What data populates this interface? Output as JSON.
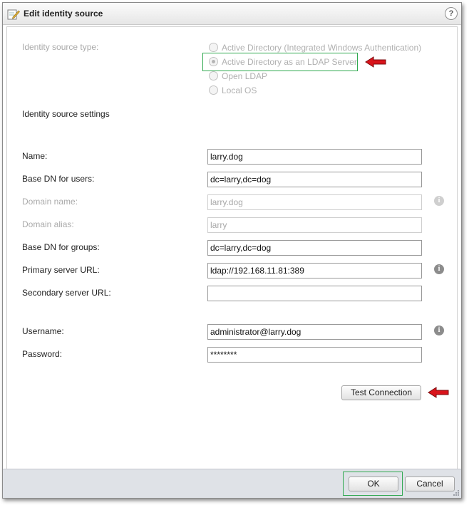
{
  "dialog": {
    "title": "Edit identity source",
    "help_label": "?",
    "icons": {
      "title": "edit-pencil-icon",
      "help": "help-icon",
      "info": "info-icon",
      "grip": "resize-grip-icon",
      "annotation": "red-arrow-icon"
    }
  },
  "source_type": {
    "label": "Identity source type:",
    "selected": "Active Directory as an LDAP Server",
    "options": [
      {
        "label": "Active Directory (Integrated Windows Authentication)",
        "checked": false
      },
      {
        "label": "Active Directory as an LDAP Server",
        "checked": true
      },
      {
        "label": "Open LDAP",
        "checked": false
      },
      {
        "label": "Local OS",
        "checked": false
      }
    ]
  },
  "settings": {
    "heading": "Identity source settings",
    "fields": {
      "name": {
        "label": "Name:",
        "value": "larry.dog"
      },
      "base_dn_users": {
        "label": "Base DN for users:",
        "value": "dc=larry,dc=dog"
      },
      "domain_name": {
        "label": "Domain name:",
        "value": "larry.dog"
      },
      "domain_alias": {
        "label": "Domain alias:",
        "value": "larry"
      },
      "base_dn_groups": {
        "label": "Base DN for groups:",
        "value": "dc=larry,dc=dog"
      },
      "primary_url": {
        "label": "Primary server URL:",
        "value": "ldap://192.168.11.81:389"
      },
      "secondary_url": {
        "label": "Secondary server URL:",
        "value": ""
      },
      "username": {
        "label": "Username:",
        "value": "administrator@larry.dog"
      },
      "password": {
        "label": "Password:",
        "value": "********"
      }
    },
    "test_connection_label": "Test Connection"
  },
  "footer": {
    "ok_label": "OK",
    "cancel_label": "Cancel"
  },
  "colors": {
    "highlight": "#2fa84f",
    "annotation_arrow": "#d9141b",
    "footer_bg": "#dfe2e7"
  }
}
